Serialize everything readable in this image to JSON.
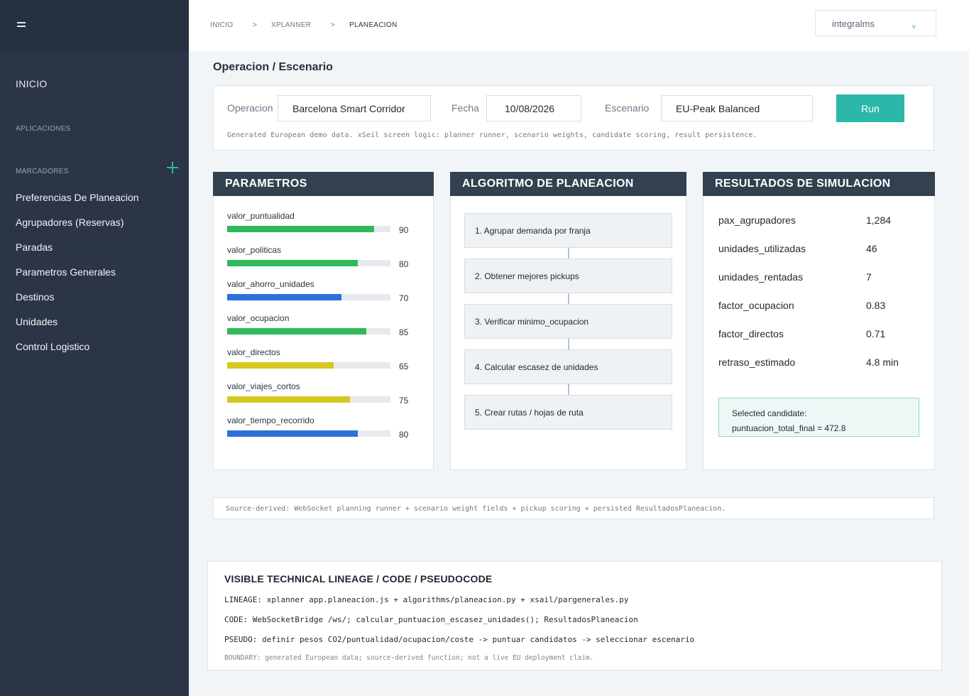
{
  "sidebar": {
    "inicio": "INICIO",
    "aplicaciones": "APLICACIONES",
    "marcadores": "MARCADORES",
    "items": [
      {
        "label": "Preferencias De Planeacion"
      },
      {
        "label": "Agrupadores (Reservas)"
      },
      {
        "label": "Paradas"
      },
      {
        "label": "Parametros Generales"
      },
      {
        "label": "Destinos"
      },
      {
        "label": "Unidades"
      },
      {
        "label": "Control Logistico"
      }
    ]
  },
  "breadcrumb": {
    "items": [
      "INICIO",
      "XPLANNER",
      "PLANEACION"
    ],
    "separator": ">"
  },
  "user": {
    "name": "integralms",
    "chevron": "v"
  },
  "page": {
    "title": "Operacion / Escenario"
  },
  "filters": {
    "operacion_label": "Operacion",
    "operacion_value": "Barcelona Smart Corridor",
    "fecha_label": "Fecha",
    "fecha_value": "10/08/2026",
    "escenario_label": "Escenario",
    "escenario_value": "EU-Peak Balanced",
    "run_label": "Run",
    "note": "Generated European demo data. xSeil screen logic: planner runner, scenario weights, candidate scoring, result persistence."
  },
  "parametros": {
    "title": "PARAMETROS",
    "items": [
      {
        "name": "valor_puntualidad",
        "value": 90,
        "color": "#2fba5a"
      },
      {
        "name": "valor_politicas",
        "value": 80,
        "color": "#2fba5a"
      },
      {
        "name": "valor_ahorro_unidades",
        "value": 70,
        "color": "#2f6fdc"
      },
      {
        "name": "valor_ocupacion",
        "value": 85,
        "color": "#2fba5a"
      },
      {
        "name": "valor_directos",
        "value": 65,
        "color": "#d6c820"
      },
      {
        "name": "valor_viajes_cortos",
        "value": 75,
        "color": "#d6c820"
      },
      {
        "name": "valor_tiempo_recorrido",
        "value": 80,
        "color": "#2f6fdc"
      }
    ]
  },
  "algoritmo": {
    "title": "ALGORITMO DE PLANEACION",
    "steps": [
      "1. Agrupar demanda por franja",
      "2. Obtener mejores pickups",
      "3. Verificar minimo_ocupacion",
      "4. Calcular escasez de unidades",
      "5. Crear rutas / hojas de ruta"
    ]
  },
  "resultados": {
    "title": "RESULTADOS DE SIMULACION",
    "rows": [
      {
        "key": "pax_agrupadores",
        "value": "1,284"
      },
      {
        "key": "unidades_utilizadas",
        "value": "46"
      },
      {
        "key": "unidades_rentadas",
        "value": "7"
      },
      {
        "key": "factor_ocupacion",
        "value": "0.83"
      },
      {
        "key": "factor_directos",
        "value": "0.71"
      },
      {
        "key": "retraso_estimado",
        "value": "4.8 min"
      }
    ],
    "candidate_label": "Selected candidate:",
    "candidate_value": "puntuacion_total_final = 472.8"
  },
  "source_note": "Source-derived: WebSocket planning runner + scenario weight fields + pickup scoring + persisted ResultadosPlaneacion.",
  "lineage": {
    "title": "VISIBLE TECHNICAL LINEAGE / CODE / PSEUDOCODE",
    "lineage_line": "LINEAGE: xplanner app.planeacion.js + algorithms/planeacion.py + xsail/pargenerales.py",
    "code_line": "CODE: WebSocketBridge /ws/; calcular_puntuacion_escasez_unidades(); ResultadosPlaneacion",
    "pseudo_line": "PSEUDO: definir pesos CO2/puntualidad/ocupacion/coste -> puntuar candidatos -> seleccionar escenario",
    "boundary_line": "BOUNDARY: generated European data; source-derived function; not a live EU deployment claim."
  }
}
